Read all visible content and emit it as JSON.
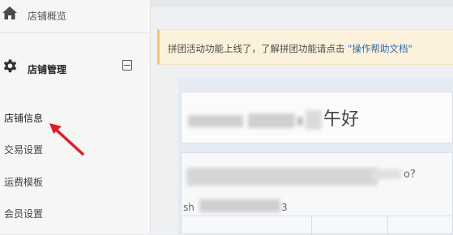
{
  "sidebar": {
    "home_label": "店铺概览",
    "group_label": "店铺管理",
    "items": [
      {
        "label": "店铺信息",
        "active": true
      },
      {
        "label": "交易设置"
      },
      {
        "label": "运费模板"
      },
      {
        "label": "会员设置"
      }
    ],
    "icons": {
      "home": "home-icon",
      "gear": "gear-icon",
      "collapse": "collapse-icon"
    }
  },
  "notice": {
    "text": "拼团活动功能上线了，了解拼团功能请点击 ",
    "link": "\"操作帮助文档\""
  },
  "main": {
    "greeting_tail": "午好",
    "question_tail": "o?",
    "id_prefix": "sh",
    "id_tail": "3"
  },
  "colors": {
    "notice_bg": "#fcf2dc",
    "notice_accent": "#f3c46a",
    "link": "#2f6aa8",
    "annotation_arrow": "#e01b24"
  }
}
